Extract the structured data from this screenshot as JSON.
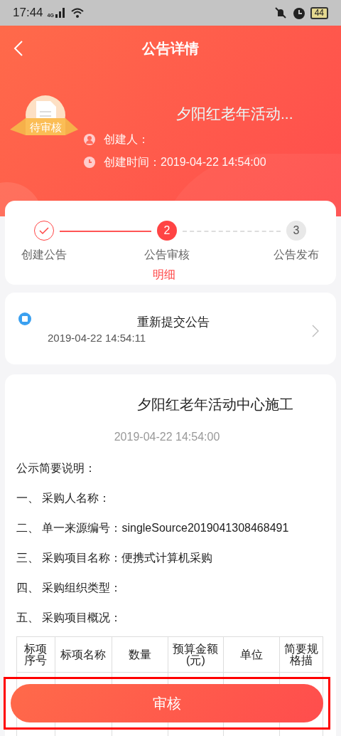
{
  "status_bar": {
    "time": "17:44",
    "network": "4G",
    "battery": "44"
  },
  "header": {
    "title": "公告详情",
    "badge": "待审核",
    "name": "夕阳红老年活动...",
    "creator_label": "创建人：",
    "created": "创建时间：2019-04-22 14:54:00"
  },
  "steps": [
    {
      "label": "创建公告",
      "completed": true,
      "selected": false
    },
    {
      "number": "2",
      "label": "公告审核",
      "completed": false,
      "selected": true
    },
    {
      "number": "3",
      "label": "公告发布",
      "completed": false,
      "selected": false
    }
  ],
  "detail_link": "明细",
  "record": {
    "title": "重新提交公告",
    "time": "2019-04-22 14:54:11"
  },
  "document": {
    "title": "夕阳红老年活动中心施工",
    "date": "2019-04-22 14:54:00",
    "lines": [
      "公示简要说明：",
      "一、 采购人名称：",
      "二、 单一来源编号：singleSource2019041308468491",
      "三、 采购项目名称：便携式计算机采购",
      "四、 采购组织类型：",
      "五、 采购项目概况："
    ],
    "table": {
      "columns": [
        "标项序号",
        "标项名称",
        "数量",
        "预算金额(元)",
        "单位",
        "简要规格描"
      ]
    }
  },
  "action_button": {
    "label": "审核",
    "highlighted": true
  }
}
